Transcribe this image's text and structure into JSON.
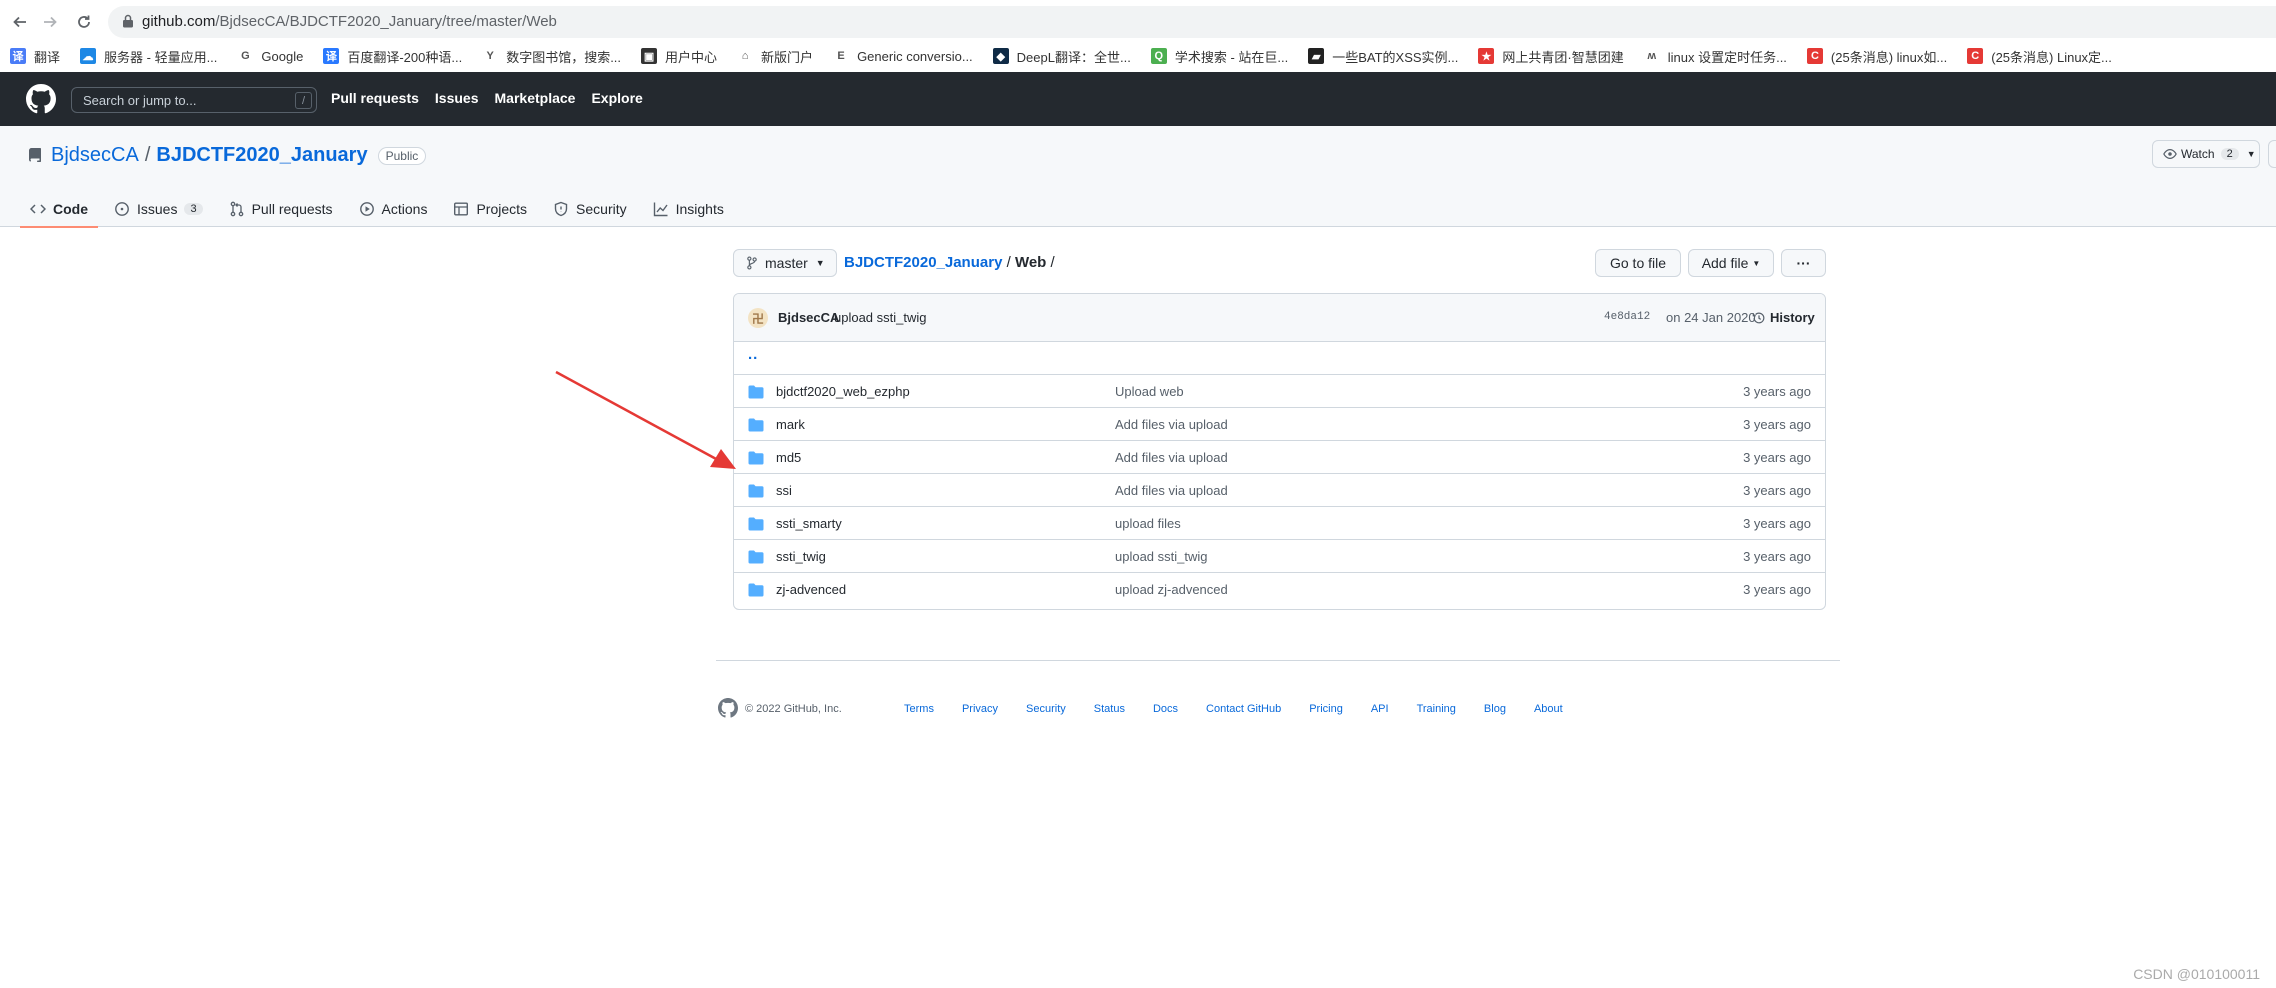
{
  "browser": {
    "url_host": "github.com",
    "url_path": "/BjdsecCA/BJDCTF2020_January/tree/master/Web",
    "bookmarks": [
      {
        "label": "翻译",
        "color": "#4a7cf7",
        "glyph": "译"
      },
      {
        "label": "服务器 - 轻量应用...",
        "color": "#1e88e5",
        "glyph": "☁"
      },
      {
        "label": "Google",
        "color": "#ffffff",
        "glyph": "G"
      },
      {
        "label": "百度翻译-200种语...",
        "color": "#2979ff",
        "glyph": "译"
      },
      {
        "label": "数字图书馆，搜索...",
        "color": "#ffffff",
        "glyph": "Y"
      },
      {
        "label": "用户中心",
        "color": "#333333",
        "glyph": "▣"
      },
      {
        "label": "新版门户",
        "color": "#ffffff",
        "glyph": "⌂"
      },
      {
        "label": "Generic conversio...",
        "color": "#ffffff",
        "glyph": "E"
      },
      {
        "label": "DeepL翻译：全世...",
        "color": "#0f2b46",
        "glyph": "◆"
      },
      {
        "label": "学术搜索 - 站在巨...",
        "color": "#4caf50",
        "glyph": "Q"
      },
      {
        "label": "一些BAT的XSS实例...",
        "color": "#222222",
        "glyph": "▰"
      },
      {
        "label": "网上共青团·智慧团建",
        "color": "#e53935",
        "glyph": "★"
      },
      {
        "label": "linux 设置定时任务...",
        "color": "#ffffff",
        "glyph": "ʍ"
      },
      {
        "label": "(25条消息) linux如...",
        "color": "#e53935",
        "glyph": "C"
      },
      {
        "label": "(25条消息) Linux定...",
        "color": "#e53935",
        "glyph": "C"
      }
    ]
  },
  "header": {
    "search_placeholder": "Search or jump to...",
    "search_key": "/",
    "nav": [
      "Pull requests",
      "Issues",
      "Marketplace",
      "Explore"
    ]
  },
  "repo": {
    "owner": "BjdsecCA",
    "separator": "/",
    "name": "BJDCTF2020_January",
    "visibility": "Public",
    "watch_label": "Watch",
    "watch_count": "2",
    "tabs": [
      {
        "label": "Code",
        "icon": "code-icon",
        "count": ""
      },
      {
        "label": "Issues",
        "icon": "issue-icon",
        "count": "3"
      },
      {
        "label": "Pull requests",
        "icon": "pull-request-icon",
        "count": ""
      },
      {
        "label": "Actions",
        "icon": "play-icon",
        "count": ""
      },
      {
        "label": "Projects",
        "icon": "table-icon",
        "count": ""
      },
      {
        "label": "Security",
        "icon": "shield-icon",
        "count": ""
      },
      {
        "label": "Insights",
        "icon": "graph-icon",
        "count": ""
      }
    ]
  },
  "file_nav": {
    "branch": "master",
    "crumb_repo": "BJDCTF2020_January",
    "crumb_sep1": "/",
    "crumb_dir": "Web",
    "crumb_sep2": "/",
    "goto_label": "Go to file",
    "add_label": "Add file",
    "more_label": "···"
  },
  "commit": {
    "author": "BjdsecCA",
    "message": "upload ssti_twig",
    "sha": "4e8da12",
    "when": "on 24 Jan 2020",
    "history_label": "History"
  },
  "updir": "..",
  "files": [
    {
      "name": "bjdctf2020_web_ezphp",
      "message": "Upload web",
      "age": "3 years ago"
    },
    {
      "name": "mark",
      "message": "Add files via upload",
      "age": "3 years ago"
    },
    {
      "name": "md5",
      "message": "Add files via upload",
      "age": "3 years ago"
    },
    {
      "name": "ssi",
      "message": "Add files via upload",
      "age": "3 years ago"
    },
    {
      "name": "ssti_smarty",
      "message": "upload files",
      "age": "3 years ago"
    },
    {
      "name": "ssti_twig",
      "message": "upload ssti_twig",
      "age": "3 years ago"
    },
    {
      "name": "zj-advenced",
      "message": "upload zj-advenced",
      "age": "3 years ago"
    }
  ],
  "footer": {
    "copyright": "© 2022 GitHub, Inc.",
    "links": [
      "Terms",
      "Privacy",
      "Security",
      "Status",
      "Docs",
      "Contact GitHub",
      "Pricing",
      "API",
      "Training",
      "Blog",
      "About"
    ]
  },
  "watermark": "CSDN @010100011",
  "colors": {
    "accent": "#0969da",
    "header_bg": "#24292f",
    "folder": "#54aeff",
    "arrow": "#e53935",
    "tab_underline": "#fd8c73"
  }
}
